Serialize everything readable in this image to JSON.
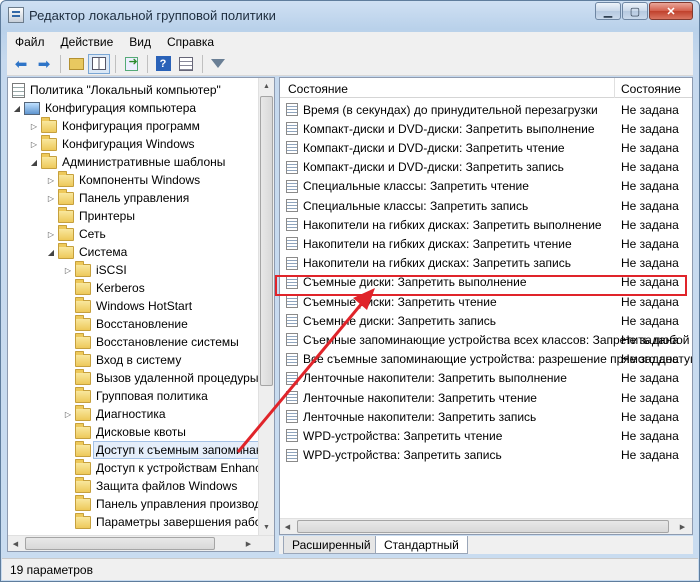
{
  "window": {
    "title": "Редактор локальной групповой политики",
    "controls": [
      "minimize",
      "maximize",
      "close"
    ]
  },
  "menu": {
    "items": [
      "Файл",
      "Действие",
      "Вид",
      "Справка"
    ]
  },
  "toolbar": {
    "icons": [
      "back-icon",
      "forward-icon",
      "up-folder-icon",
      "show-tree-icon",
      "export-icon",
      "help-icon",
      "properties-icon",
      "filter-icon"
    ]
  },
  "tree": {
    "root": "Политика \"Локальный компьютер\"",
    "items": [
      {
        "label": "Конфигурация компьютера",
        "level": 1,
        "expand": "open",
        "icon": "computer"
      },
      {
        "label": "Конфигурация программ",
        "level": 2,
        "expand": "closed",
        "icon": "folder"
      },
      {
        "label": "Конфигурация Windows",
        "level": 2,
        "expand": "closed",
        "icon": "folder"
      },
      {
        "label": "Административные шаблоны",
        "level": 2,
        "expand": "open",
        "icon": "folder"
      },
      {
        "label": "Компоненты Windows",
        "level": 3,
        "expand": "closed",
        "icon": "folder"
      },
      {
        "label": "Панель управления",
        "level": 3,
        "expand": "closed",
        "icon": "folder"
      },
      {
        "label": "Принтеры",
        "level": 3,
        "expand": "none",
        "icon": "folder"
      },
      {
        "label": "Сеть",
        "level": 3,
        "expand": "closed",
        "icon": "folder"
      },
      {
        "label": "Система",
        "level": 3,
        "expand": "open",
        "icon": "folder"
      },
      {
        "label": "iSCSI",
        "level": 4,
        "expand": "closed",
        "icon": "folder"
      },
      {
        "label": "Kerberos",
        "level": 4,
        "expand": "none",
        "icon": "folder"
      },
      {
        "label": "Windows HotStart",
        "level": 4,
        "expand": "none",
        "icon": "folder"
      },
      {
        "label": "Восстановление",
        "level": 4,
        "expand": "none",
        "icon": "folder"
      },
      {
        "label": "Восстановление системы",
        "level": 4,
        "expand": "none",
        "icon": "folder"
      },
      {
        "label": "Вход в систему",
        "level": 4,
        "expand": "none",
        "icon": "folder"
      },
      {
        "label": "Вызов удаленной процедуры",
        "level": 4,
        "expand": "none",
        "icon": "folder"
      },
      {
        "label": "Групповая политика",
        "level": 4,
        "expand": "none",
        "icon": "folder"
      },
      {
        "label": "Диагностика",
        "level": 4,
        "expand": "closed",
        "icon": "folder"
      },
      {
        "label": "Дисковые квоты",
        "level": 4,
        "expand": "none",
        "icon": "folder"
      },
      {
        "label": "Доступ к съемным запоминающим устройствам",
        "level": 4,
        "expand": "none",
        "icon": "folder",
        "selected": true
      },
      {
        "label": "Доступ к устройствам Enhanced Storage",
        "level": 4,
        "expand": "none",
        "icon": "folder"
      },
      {
        "label": "Защита файлов Windows",
        "level": 4,
        "expand": "none",
        "icon": "folder"
      },
      {
        "label": "Панель управления производительностью",
        "level": 4,
        "expand": "none",
        "icon": "folder"
      },
      {
        "label": "Параметры завершения работы",
        "level": 4,
        "expand": "none",
        "icon": "folder"
      }
    ]
  },
  "list": {
    "col_name": "Состояние",
    "col_state": "Состояние",
    "rows": [
      {
        "name": "Время (в секундах) до принудительной перезагрузки",
        "state": "Не задана"
      },
      {
        "name": "Компакт-диски и DVD-диски: Запретить выполнение",
        "state": "Не задана"
      },
      {
        "name": "Компакт-диски и DVD-диски: Запретить чтение",
        "state": "Не задана"
      },
      {
        "name": "Компакт-диски и DVD-диски: Запретить запись",
        "state": "Не задана"
      },
      {
        "name": "Специальные классы: Запретить чтение",
        "state": "Не задана"
      },
      {
        "name": "Специальные классы: Запретить запись",
        "state": "Не задана"
      },
      {
        "name": "Накопители на гибких дисках: Запретить выполнение",
        "state": "Не задана"
      },
      {
        "name": "Накопители на гибких дисках: Запретить чтение",
        "state": "Не задана"
      },
      {
        "name": "Накопители на гибких дисках: Запретить запись",
        "state": "Не задана"
      },
      {
        "name": "Съемные диски: Запретить выполнение",
        "state": "Не задана",
        "highlighted": true
      },
      {
        "name": "Съемные диски: Запретить чтение",
        "state": "Не задана"
      },
      {
        "name": "Съемные диски: Запретить запись",
        "state": "Не задана"
      },
      {
        "name": "Съемные запоминающие устройства всех классов: Запретить любой доступ",
        "state": "Не задана"
      },
      {
        "name": "Все съемные запоминающие устройства: разрешение прямого доступа",
        "state": "Не задана"
      },
      {
        "name": "Ленточные накопители: Запретить выполнение",
        "state": "Не задана"
      },
      {
        "name": "Ленточные накопители: Запретить чтение",
        "state": "Не задана"
      },
      {
        "name": "Ленточные накопители: Запретить запись",
        "state": "Не задана"
      },
      {
        "name": "WPD-устройства: Запретить чтение",
        "state": "Не задана"
      },
      {
        "name": "WPD-устройства: Запретить запись",
        "state": "Не задана"
      }
    ]
  },
  "tabs": [
    "Расширенный",
    "Стандартный"
  ],
  "status": "19 параметров",
  "colors": {
    "highlight": "#e0242a",
    "selection": "#e5eefa"
  }
}
